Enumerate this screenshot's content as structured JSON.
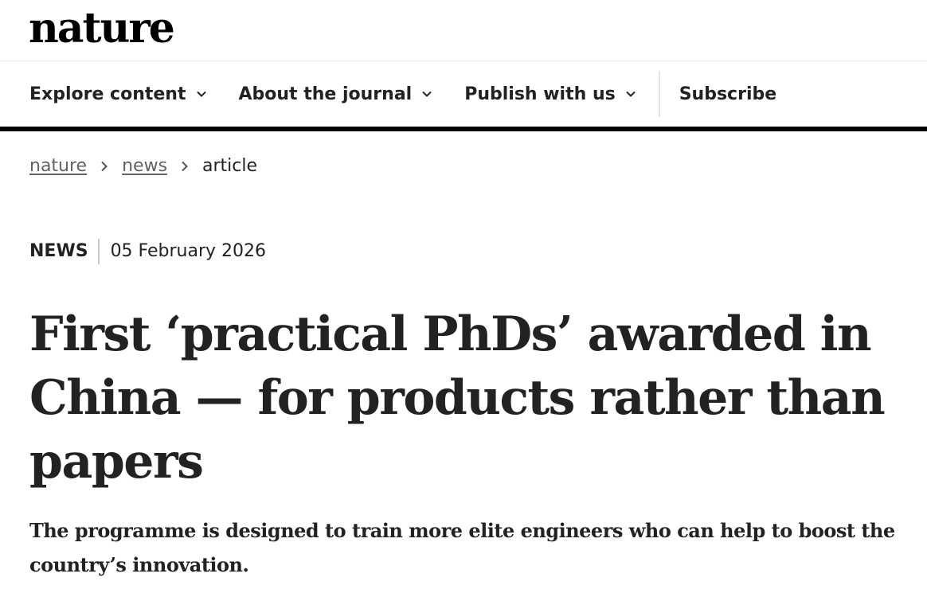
{
  "site": {
    "logo_text": "nature"
  },
  "nav": {
    "items": [
      {
        "label": "Explore content",
        "icon": "chevron-down-icon"
      },
      {
        "label": "About the journal",
        "icon": "chevron-down-icon"
      },
      {
        "label": "Publish with us",
        "icon": "chevron-down-icon"
      }
    ],
    "subscribe_label": "Subscribe"
  },
  "breadcrumb": {
    "items": [
      {
        "label": "nature"
      },
      {
        "label": "news"
      }
    ],
    "current": "article",
    "separator_icon": "chevron-right-icon"
  },
  "article": {
    "type": "NEWS",
    "date": "05 February 2026",
    "title": "First ‘practical PhDs’ awarded in China — for products rather than papers",
    "standfirst": "The programme is designed to train more elite engineers who can help to boost the country’s innovation."
  }
}
